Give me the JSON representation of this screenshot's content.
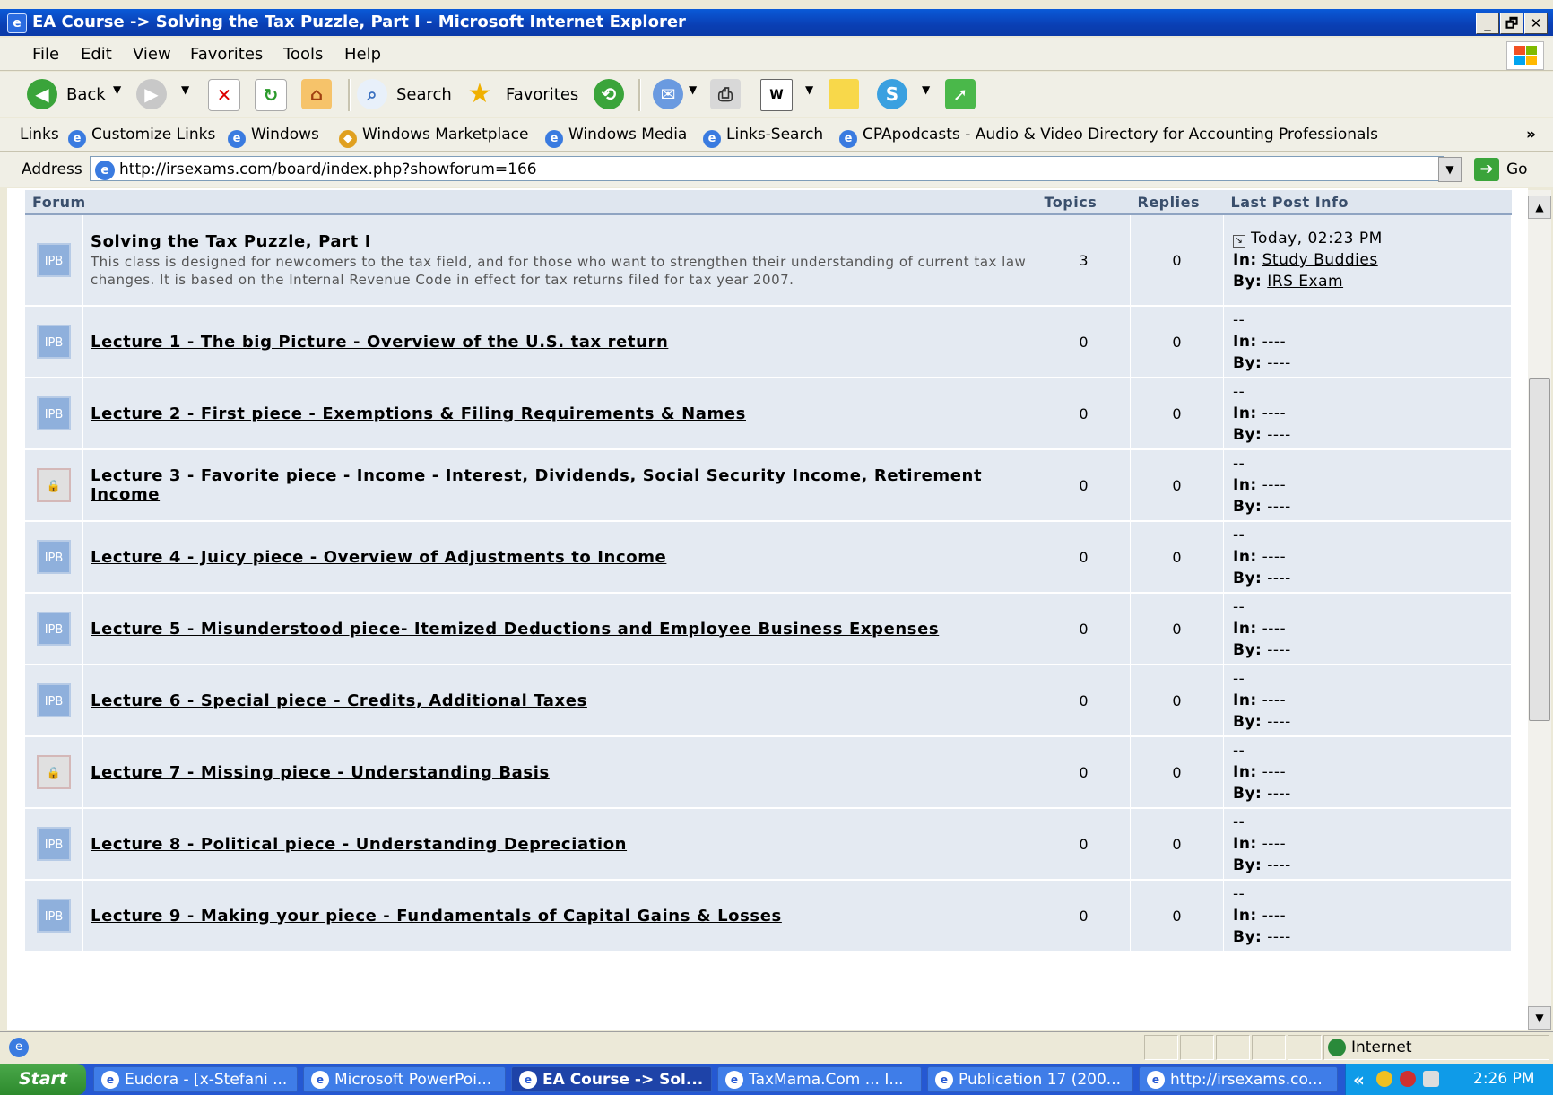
{
  "window": {
    "title": "EA Course -> Solving the Tax Puzzle, Part I - Microsoft Internet Explorer",
    "controls": {
      "minimize": "_",
      "maximize": "🗗",
      "close": "✕"
    }
  },
  "menu": [
    "File",
    "Edit",
    "View",
    "Favorites",
    "Tools",
    "Help"
  ],
  "toolbar": {
    "back": "Back",
    "search": "Search",
    "favorites": "Favorites"
  },
  "links": {
    "label": "Links",
    "items": [
      "Customize Links",
      "Windows",
      "Windows Marketplace",
      "Windows Media",
      "Links-Search",
      "CPApodcasts - Audio & Video Directory for Accounting Professionals"
    ],
    "more": "»"
  },
  "address": {
    "label": "Address",
    "url": "http://irsexams.com/board/index.php?showforum=166",
    "go": "Go"
  },
  "table": {
    "headers": {
      "forum": "Forum",
      "topics": "Topics",
      "replies": "Replies",
      "last_post": "Last Post Info"
    },
    "icon_text": "IPB",
    "rows": [
      {
        "title": "Solving the Tax Puzzle, Part I",
        "desc": "This class is designed for newcomers to the tax field, and for those who want to strengthen their understanding of current tax law changes. It is based on the Internal Revenue Code in effect for tax returns filed for tax year 2007.",
        "topics": "3",
        "replies": "0",
        "date": "Today, 02:23 PM",
        "in_label": "In:",
        "in": "Study Buddies",
        "by_label": "By:",
        "by": "IRS Exam",
        "locked": false
      },
      {
        "title": "Lecture 1 - The big Picture - Overview of the U.S. tax return",
        "topics": "0",
        "replies": "0",
        "date": "--",
        "in_label": "In:",
        "in": "----",
        "by_label": "By:",
        "by": "----",
        "locked": false
      },
      {
        "title": "Lecture 2 - First piece - Exemptions & Filing Requirements & Names",
        "topics": "0",
        "replies": "0",
        "date": "--",
        "in_label": "In:",
        "in": "----",
        "by_label": "By:",
        "by": "----",
        "locked": false
      },
      {
        "title": "Lecture 3 - Favorite piece - Income - Interest, Dividends, Social Security Income, Retirement Income",
        "topics": "0",
        "replies": "0",
        "date": "--",
        "in_label": "In:",
        "in": "----",
        "by_label": "By:",
        "by": "----",
        "locked": true
      },
      {
        "title": "Lecture 4 - Juicy piece - Overview of Adjustments to Income",
        "topics": "0",
        "replies": "0",
        "date": "--",
        "in_label": "In:",
        "in": "----",
        "by_label": "By:",
        "by": "----",
        "locked": false
      },
      {
        "title": "Lecture 5 - Misunderstood piece- Itemized Deductions and Employee Business Expenses",
        "topics": "0",
        "replies": "0",
        "date": "--",
        "in_label": "In:",
        "in": "----",
        "by_label": "By:",
        "by": "----",
        "locked": false
      },
      {
        "title": "Lecture 6 - Special piece - Credits, Additional Taxes",
        "topics": "0",
        "replies": "0",
        "date": "--",
        "in_label": "In:",
        "in": "----",
        "by_label": "By:",
        "by": "----",
        "locked": false
      },
      {
        "title": "Lecture 7 - Missing piece - Understanding Basis",
        "topics": "0",
        "replies": "0",
        "date": "--",
        "in_label": "In:",
        "in": "----",
        "by_label": "By:",
        "by": "----",
        "locked": true
      },
      {
        "title": "Lecture 8 - Political piece - Understanding Depreciation",
        "topics": "0",
        "replies": "0",
        "date": "--",
        "in_label": "In:",
        "in": "----",
        "by_label": "By:",
        "by": "----",
        "locked": false
      },
      {
        "title": "Lecture 9 - Making your piece - Fundamentals of Capital Gains & Losses",
        "topics": "0",
        "replies": "0",
        "date": "--",
        "in_label": "In:",
        "in": "----",
        "by_label": "By:",
        "by": "----",
        "locked": false
      }
    ]
  },
  "status": {
    "zone": "Internet"
  },
  "taskbar": {
    "start": "Start",
    "tasks": [
      {
        "label": "Eudora - [x-Stefani ...",
        "active": false
      },
      {
        "label": "Microsoft PowerPoi...",
        "active": false
      },
      {
        "label": "EA Course -> Sol...",
        "active": true
      },
      {
        "label": "TaxMama.Com ... I...",
        "active": false
      },
      {
        "label": "Publication 17 (200...",
        "active": false
      },
      {
        "label": "http://irsexams.co...",
        "active": false
      }
    ],
    "tray_chevron": "«",
    "clock": "2:26 PM"
  },
  "colors": {
    "titlebar": "#0a5ad8",
    "row_bg": "#e4eaf2",
    "header_bg": "#dfe6ef",
    "taskbar": "#2558d2",
    "tray": "#0f9be8"
  },
  "icons": [
    "ie-icon",
    "back-arrow-icon",
    "forward-arrow-icon",
    "stop-icon",
    "refresh-icon",
    "home-icon",
    "search-icon",
    "favorites-star-icon",
    "history-icon",
    "mail-icon",
    "print-icon",
    "edit-icon",
    "notes-icon",
    "messenger-icon",
    "go-arrow-icon",
    "globe-icon",
    "windows-flag-icon"
  ]
}
